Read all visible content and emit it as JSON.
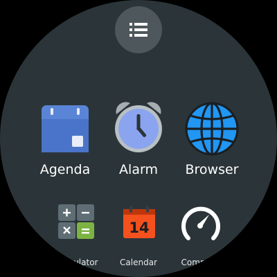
{
  "menu": {
    "icon": "list-icon"
  },
  "apps_row1": [
    {
      "label": "Agenda",
      "icon": "agenda-icon"
    },
    {
      "label": "Alarm",
      "icon": "alarm-clock-icon"
    },
    {
      "label": "Browser",
      "icon": "globe-icon"
    }
  ],
  "apps_row2": [
    {
      "label": "Calculator",
      "icon": "calculator-icon"
    },
    {
      "label": "Calendar",
      "icon": "calendar-icon",
      "date": "14"
    },
    {
      "label": "Compass",
      "icon": "speedometer-icon"
    }
  ],
  "colors": {
    "background": "#2b3539",
    "menu_button": "#4e575b",
    "agenda": "#4a74c9",
    "alarm_face": "#8aa4f0",
    "browser": "#2196f3",
    "calculator_plus": "#7cb342",
    "calendar": "#f4511e"
  }
}
